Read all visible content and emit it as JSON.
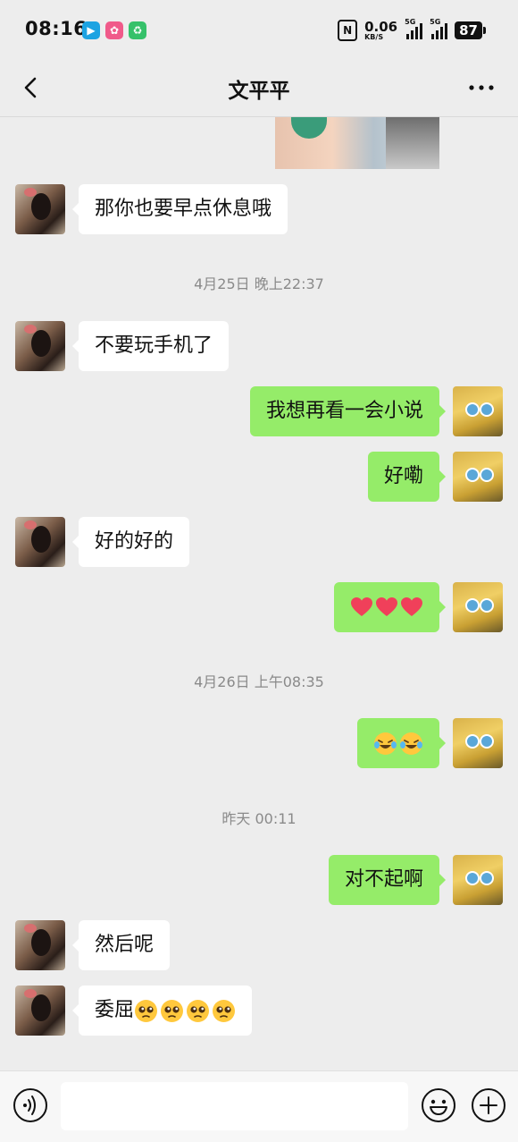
{
  "status_bar": {
    "time": "08:16",
    "net_speed_value": "0.06",
    "net_speed_unit": "KB/S",
    "signal1_label": "5G",
    "signal2_label": "5G",
    "battery": "87"
  },
  "header": {
    "title": "文平平"
  },
  "messages": [
    {
      "side": "left",
      "text": "那你也要早点休息哦"
    },
    {
      "side": "left",
      "text": "不要玩手机了"
    },
    {
      "side": "right",
      "text": "我想再看一会小说"
    },
    {
      "side": "right",
      "text": "好嘞"
    },
    {
      "side": "left",
      "text": "好的好的"
    },
    {
      "side": "right",
      "emoji": "heart-icon",
      "emoji_count": 3
    },
    {
      "side": "right",
      "emoji": "laugh-crying-icon",
      "emoji_count": 2
    },
    {
      "side": "right",
      "text": "对不起啊"
    },
    {
      "side": "left",
      "text": "然后呢"
    },
    {
      "side": "left",
      "text": "委屈",
      "emoji": "pleading-face-icon",
      "emoji_count": 4
    }
  ],
  "timestamps": [
    "4月25日 晚上22:37",
    "4月26日 上午08:35",
    "昨天 00:11"
  ],
  "input": {
    "placeholder": ""
  },
  "colors": {
    "background": "#ededed",
    "sent_bubble": "#95ec69",
    "received_bubble": "#ffffff"
  }
}
